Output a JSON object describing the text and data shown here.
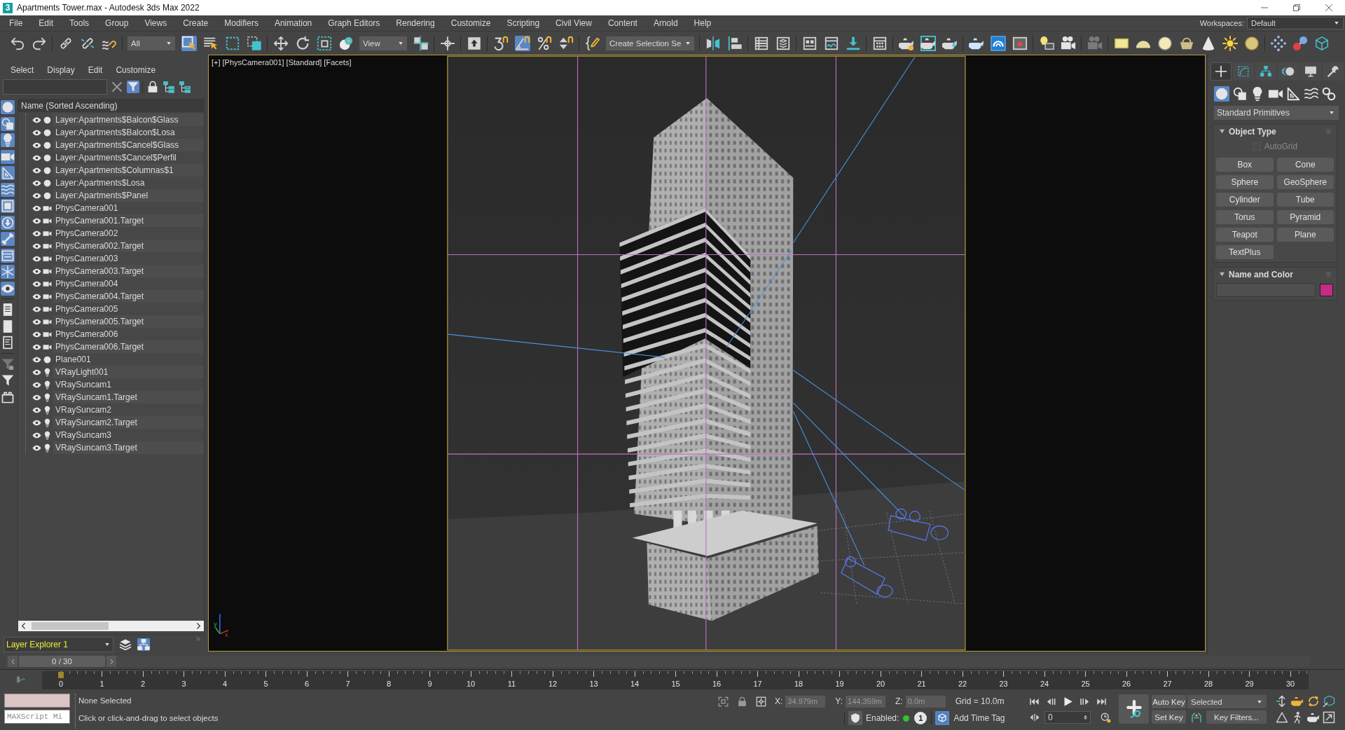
{
  "window": {
    "logo": "3",
    "title": "Apartments Tower.max - Autodesk 3ds Max 2022"
  },
  "menu_bar": {
    "items": [
      "File",
      "Edit",
      "Tools",
      "Group",
      "Views",
      "Create",
      "Modifiers",
      "Animation",
      "Graph Editors",
      "Rendering",
      "Customize",
      "Scripting",
      "Civil View",
      "Content",
      "Arnold",
      "Help"
    ],
    "workspaces_label": "Workspaces:",
    "workspace": "Default"
  },
  "toolbar": {
    "groups": [
      [
        {
          "kind": "undo",
          "on": false
        },
        {
          "kind": "redo",
          "on": false
        }
      ],
      [
        {
          "kind": "link",
          "on": false
        },
        {
          "kind": "unlink",
          "on": false
        },
        {
          "kind": "bind",
          "on": false
        }
      ],
      [
        {
          "kind": "dropdown",
          "value": "All"
        },
        {
          "kind": "select",
          "on": true
        },
        {
          "kind": "selname",
          "on": false
        },
        {
          "kind": "rect",
          "on": false
        },
        {
          "kind": "crossing",
          "on": false
        }
      ],
      [
        {
          "kind": "move",
          "on": false
        },
        {
          "kind": "rotate",
          "on": false
        },
        {
          "kind": "scale",
          "on": false
        },
        {
          "kind": "place",
          "on": false
        },
        {
          "kind": "dropdown",
          "value": "View"
        },
        {
          "kind": "pivot",
          "on": false
        }
      ],
      [
        {
          "kind": "manipulate",
          "on": false
        }
      ],
      [
        {
          "kind": "shortcut",
          "on": false
        }
      ],
      [
        {
          "kind": "snap",
          "on": false
        },
        {
          "kind": "angle_snap",
          "on": true
        },
        {
          "kind": "percent_snap",
          "on": false
        },
        {
          "kind": "spinner_snap",
          "on": false
        }
      ],
      [
        {
          "kind": "named_sets",
          "on": false
        },
        {
          "kind": "dropdown",
          "value": "Create Selection Se"
        }
      ],
      [
        {
          "kind": "mirror",
          "on": false
        },
        {
          "kind": "align",
          "on": false
        }
      ],
      [
        {
          "kind": "scene_explorer",
          "on": false
        },
        {
          "kind": "layer_explorer",
          "on": false
        }
      ],
      [
        {
          "kind": "ribbon",
          "on": false
        },
        {
          "kind": "curve_editor",
          "on": false
        },
        {
          "kind": "schematic",
          "on": false
        }
      ],
      [
        {
          "kind": "material_editor",
          "on": false
        }
      ],
      [
        {
          "kind": "render_setup",
          "on": false
        },
        {
          "kind": "frame_window",
          "on": false
        },
        {
          "kind": "render",
          "on": false
        }
      ],
      [
        {
          "kind": "teapot",
          "on": false
        },
        {
          "kind": "arnold",
          "on": false
        },
        {
          "kind": "image",
          "on": false
        }
      ],
      [
        {
          "kind": "light_list",
          "on": false
        },
        {
          "kind": "camera",
          "on": false
        }
      ],
      [
        {
          "kind": "camera_off",
          "on": false
        }
      ],
      [
        {
          "kind": "panel_light",
          "on": false
        },
        {
          "kind": "dome_light",
          "on": false
        },
        {
          "kind": "sphere_light",
          "on": false
        },
        {
          "kind": "basket",
          "on": false
        },
        {
          "kind": "cone",
          "on": false
        },
        {
          "kind": "sun",
          "on": false
        },
        {
          "kind": "orb",
          "on": false
        }
      ],
      [
        {
          "kind": "grid",
          "on": false
        },
        {
          "kind": "molecule",
          "on": false
        },
        {
          "kind": "cube",
          "on": false
        }
      ]
    ]
  },
  "scene_explorer": {
    "menu": [
      "Select",
      "Display",
      "Edit",
      "Customize"
    ],
    "tools": [
      [
        {
          "kind": "clear",
          "on": false
        },
        {
          "kind": "filter",
          "on": true
        }
      ],
      [
        {
          "kind": "lock",
          "on": false
        },
        {
          "kind": "expand",
          "on": false
        },
        {
          "kind": "collapse",
          "on": false
        }
      ]
    ],
    "filters": [
      [
        {
          "kind": "geometry",
          "on": true
        },
        {
          "kind": "shapes",
          "on": true
        },
        {
          "kind": "lights",
          "on": true
        },
        {
          "kind": "cameras",
          "on": true
        },
        {
          "kind": "helpers",
          "on": true
        },
        {
          "kind": "space_warps",
          "on": true
        },
        {
          "kind": "groups",
          "on": true
        },
        {
          "kind": "xrefs",
          "on": true
        },
        {
          "kind": "bones",
          "on": true
        },
        {
          "kind": "containers",
          "on": true
        },
        {
          "kind": "frozen",
          "on": true
        },
        {
          "kind": "hidden",
          "on": true
        }
      ],
      [
        {
          "kind": "display_children",
          "on": false
        },
        {
          "kind": "display_all",
          "on": false
        },
        {
          "kind": "display_dependents",
          "on": false
        }
      ],
      [
        {
          "kind": "filter_settings",
          "on": false
        },
        {
          "kind": "filter",
          "on": false
        },
        {
          "kind": "container",
          "on": false
        }
      ]
    ],
    "column": "Name (Sorted Ascending)",
    "rows": [
      {
        "name": "Layer:Apartments$Balcon$Glass",
        "kind": "geometry",
        "visible": true
      },
      {
        "name": "Layer:Apartments$Balcon$Losa",
        "kind": "geometry",
        "visible": true
      },
      {
        "name": "Layer:Apartments$Cancel$Glass",
        "kind": "geometry",
        "visible": true
      },
      {
        "name": "Layer:Apartments$Cancel$Perfil",
        "kind": "geometry",
        "visible": true
      },
      {
        "name": "Layer:Apartments$Columnas$1",
        "kind": "geometry",
        "visible": true
      },
      {
        "name": "Layer:Apartments$Losa",
        "kind": "geometry",
        "visible": true
      },
      {
        "name": "Layer:Apartments$Panel",
        "kind": "geometry",
        "visible": true
      },
      {
        "name": "PhysCamera001",
        "kind": "camera",
        "visible": true
      },
      {
        "name": "PhysCamera001.Target",
        "kind": "camera",
        "visible": true
      },
      {
        "name": "PhysCamera002",
        "kind": "camera",
        "visible": true
      },
      {
        "name": "PhysCamera002.Target",
        "kind": "camera",
        "visible": true
      },
      {
        "name": "PhysCamera003",
        "kind": "camera",
        "visible": true
      },
      {
        "name": "PhysCamera003.Target",
        "kind": "camera",
        "visible": true
      },
      {
        "name": "PhysCamera004",
        "kind": "camera",
        "visible": true
      },
      {
        "name": "PhysCamera004.Target",
        "kind": "camera",
        "visible": true
      },
      {
        "name": "PhysCamera005",
        "kind": "camera",
        "visible": true
      },
      {
        "name": "PhysCamera005.Target",
        "kind": "camera",
        "visible": true
      },
      {
        "name": "PhysCamera006",
        "kind": "camera",
        "visible": true
      },
      {
        "name": "PhysCamera006.Target",
        "kind": "camera",
        "visible": true
      },
      {
        "name": "Plane001",
        "kind": "geometry",
        "visible": true
      },
      {
        "name": "VRayLight001",
        "kind": "light",
        "visible": true
      },
      {
        "name": "VRaySuncam1",
        "kind": "light",
        "visible": true
      },
      {
        "name": "VRaySuncam1.Target",
        "kind": "light",
        "visible": true
      },
      {
        "name": "VRaySuncam2",
        "kind": "light",
        "visible": true
      },
      {
        "name": "VRaySuncam2.Target",
        "kind": "light",
        "visible": true
      },
      {
        "name": "VRaySuncam3",
        "kind": "light",
        "visible": true
      },
      {
        "name": "VRaySuncam3.Target",
        "kind": "light",
        "visible": true
      }
    ],
    "explorer_name": "Layer Explorer 1",
    "modes": [
      {
        "kind": "layers",
        "on": false
      },
      {
        "kind": "hierarchy",
        "on": true
      }
    ]
  },
  "viewport": {
    "labels": [
      "[+]",
      "[PhysCamera001]",
      "[Standard]",
      "[Facets]"
    ],
    "axis_labels": [
      "y",
      "x"
    ]
  },
  "command_panel": {
    "tabs": [
      {
        "kind": "create",
        "selected": true
      },
      {
        "kind": "modify",
        "selected": false
      },
      {
        "kind": "hierarchy",
        "selected": false
      },
      {
        "kind": "motion",
        "selected": false
      },
      {
        "kind": "display",
        "selected": false
      },
      {
        "kind": "utilities",
        "selected": false
      }
    ],
    "categories": [
      {
        "kind": "geometry",
        "selected": true
      },
      {
        "kind": "shapes",
        "selected": false
      },
      {
        "kind": "lights",
        "selected": false
      },
      {
        "kind": "cameras",
        "selected": false
      },
      {
        "kind": "helpers",
        "selected": false
      },
      {
        "kind": "space_warps",
        "selected": false
      },
      {
        "kind": "systems",
        "selected": false
      }
    ],
    "category_dropdown": "Standard Primitives",
    "object_type": {
      "title": "Object Type",
      "expanded": true,
      "autogrid": {
        "label": "AutoGrid",
        "checked": false,
        "disabled": true
      },
      "buttons": [
        "Box",
        "Cone",
        "Sphere",
        "GeoSphere",
        "Cylinder",
        "Tube",
        "Torus",
        "Pyramid",
        "Teapot",
        "Plane",
        "TextPlus"
      ]
    },
    "name_and_color": {
      "title": "Name and Color",
      "expanded": true,
      "color": "#c42c84"
    }
  },
  "time_slider": {
    "label": "0 / 30",
    "level": 0
  },
  "timeline": {
    "ticks": [
      "0",
      "1",
      "2",
      "3",
      "4",
      "5",
      "6",
      "7",
      "8",
      "9",
      "10",
      "11",
      "12",
      "13",
      "14",
      "15",
      "16",
      "17",
      "18",
      "19",
      "20",
      "21",
      "22",
      "23",
      "24",
      "25",
      "26",
      "27",
      "28",
      "29",
      "30"
    ]
  },
  "status_bar": {
    "listener_placeholder": "MAXScript Mi",
    "selection": "None Selected",
    "prompt": "Click or click-and-drag to select objects",
    "coordinates": [
      {
        "label": "X:",
        "value": "34.979m"
      },
      {
        "label": "Y:",
        "value": "144.359m"
      },
      {
        "label": "Z:",
        "value": "0.0m"
      }
    ],
    "coords_disabled": true,
    "grid": "Grid = 10.0m",
    "time_tag": {
      "label": "Enabled:",
      "enabled": true,
      "badge": "1",
      "button": "Add Time Tag"
    },
    "frame": "0",
    "auto_key": {
      "label": "Auto Key",
      "on": false
    },
    "key_set": "Selected",
    "set_key": "Set Key",
    "key_filters": "Key Filters..."
  }
}
